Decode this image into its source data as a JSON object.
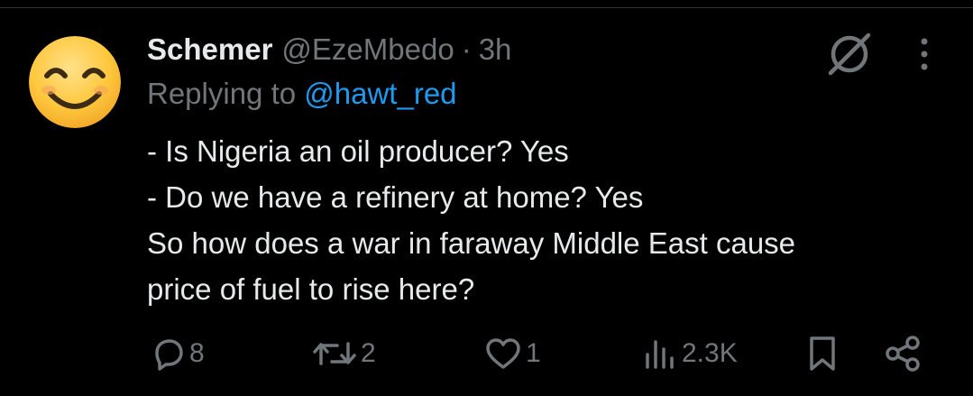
{
  "author": {
    "display_name": "Schemer",
    "handle": "@EzeMbedo",
    "separator": "·",
    "time": "3h",
    "avatar_icon": "smiling-face-emoji"
  },
  "reply_context": {
    "prefix": "Replying to ",
    "mention": "@hawt_red"
  },
  "tweet_text": {
    "lines": [
      "- Is Nigeria an oil producer? Yes",
      "- Do we have a refinery at home? Yes",
      "So how does a war in faraway Middle East cause",
      "price of fuel to rise here?"
    ]
  },
  "actions": {
    "reply_count": "8",
    "repost_count": "2",
    "like_count": "1",
    "views_count": "2.3K"
  },
  "icons": {
    "grok": "grok-icon",
    "more": "more-vertical-icon",
    "reply": "reply-icon",
    "repost": "repost-icon",
    "like": "heart-icon",
    "views": "views-icon",
    "bookmark": "bookmark-icon",
    "share": "share-icon"
  },
  "colors": {
    "background": "#000000",
    "text_primary": "#e7e9ea",
    "text_secondary": "#71767b",
    "accent": "#1d9bf0",
    "emoji_yellow": "#ffc83d"
  }
}
